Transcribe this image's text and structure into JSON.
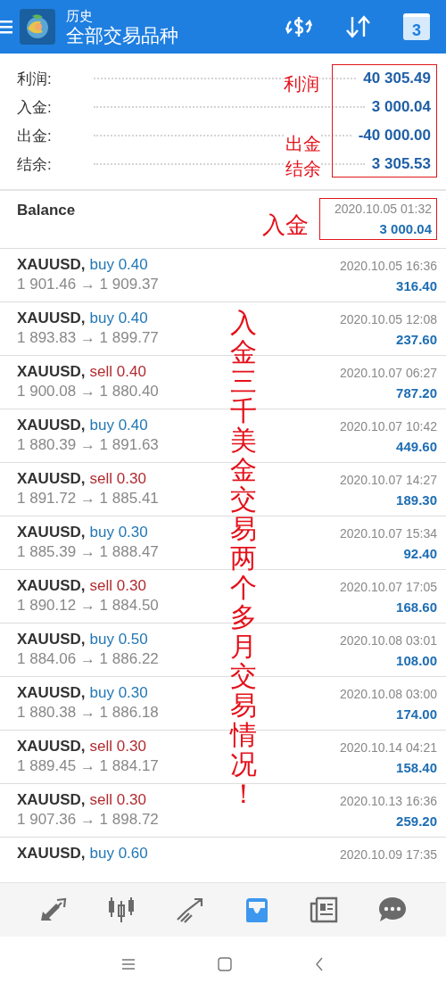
{
  "header": {
    "subtitle": "历史",
    "title": "全部交易品种",
    "calendar_day": "3"
  },
  "summary": [
    {
      "label": "利润:",
      "value": "40 305.49"
    },
    {
      "label": "入金:",
      "value": "3 000.04"
    },
    {
      "label": "出金:",
      "value": "-40 000.00"
    },
    {
      "label": "结余:",
      "value": "3 305.53"
    }
  ],
  "balance": {
    "label": "Balance",
    "time": "2020.10.05 01:32",
    "amount": "3 000.04"
  },
  "trades": [
    {
      "symbol": "XAUUSD,",
      "kind": "buy",
      "order": "buy 0.40",
      "prices": "1 901.46 → 1 909.37",
      "time": "2020.10.05 16:36",
      "profit": "316.40"
    },
    {
      "symbol": "XAUUSD,",
      "kind": "buy",
      "order": "buy 0.40",
      "prices": "1 893.83 → 1 899.77",
      "time": "2020.10.05 12:08",
      "profit": "237.60"
    },
    {
      "symbol": "XAUUSD,",
      "kind": "sell",
      "order": "sell 0.40",
      "prices": "1 900.08 → 1 880.40",
      "time": "2020.10.07 06:27",
      "profit": "787.20"
    },
    {
      "symbol": "XAUUSD,",
      "kind": "buy",
      "order": "buy 0.40",
      "prices": "1 880.39 → 1 891.63",
      "time": "2020.10.07 10:42",
      "profit": "449.60"
    },
    {
      "symbol": "XAUUSD,",
      "kind": "sell",
      "order": "sell 0.30",
      "prices": "1 891.72 → 1 885.41",
      "time": "2020.10.07 14:27",
      "profit": "189.30"
    },
    {
      "symbol": "XAUUSD,",
      "kind": "buy",
      "order": "buy 0.30",
      "prices": "1 885.39 → 1 888.47",
      "time": "2020.10.07 15:34",
      "profit": "92.40"
    },
    {
      "symbol": "XAUUSD,",
      "kind": "sell",
      "order": "sell 0.30",
      "prices": "1 890.12 → 1 884.50",
      "time": "2020.10.07 17:05",
      "profit": "168.60"
    },
    {
      "symbol": "XAUUSD,",
      "kind": "buy",
      "order": "buy 0.50",
      "prices": "1 884.06 → 1 886.22",
      "time": "2020.10.08 03:01",
      "profit": "108.00"
    },
    {
      "symbol": "XAUUSD,",
      "kind": "buy",
      "order": "buy 0.30",
      "prices": "1 880.38 → 1 886.18",
      "time": "2020.10.08 03:00",
      "profit": "174.00"
    },
    {
      "symbol": "XAUUSD,",
      "kind": "sell",
      "order": "sell 0.30",
      "prices": "1 889.45 → 1 884.17",
      "time": "2020.10.14 04:21",
      "profit": "158.40"
    },
    {
      "symbol": "XAUUSD,",
      "kind": "sell",
      "order": "sell 0.30",
      "prices": "1 907.36 → 1 898.72",
      "time": "2020.10.13 16:36",
      "profit": "259.20"
    },
    {
      "symbol": "XAUUSD,",
      "kind": "buy",
      "order": "buy 0.60",
      "time": "2020.10.09 17:35"
    }
  ],
  "bottom_nav": [
    {
      "kind": "trade",
      "selected": false
    },
    {
      "kind": "chart",
      "selected": false
    },
    {
      "kind": "trend",
      "selected": false
    },
    {
      "kind": "history",
      "selected": true
    },
    {
      "kind": "news",
      "selected": false
    },
    {
      "kind": "chat",
      "selected": false
    }
  ],
  "annotations": {
    "profit_note": "利润",
    "withdraw_note": "出金",
    "balance_note": "结余",
    "deposit_note": "入金",
    "vertical_note": "入金三千美金交易两个多月交易情况！"
  }
}
